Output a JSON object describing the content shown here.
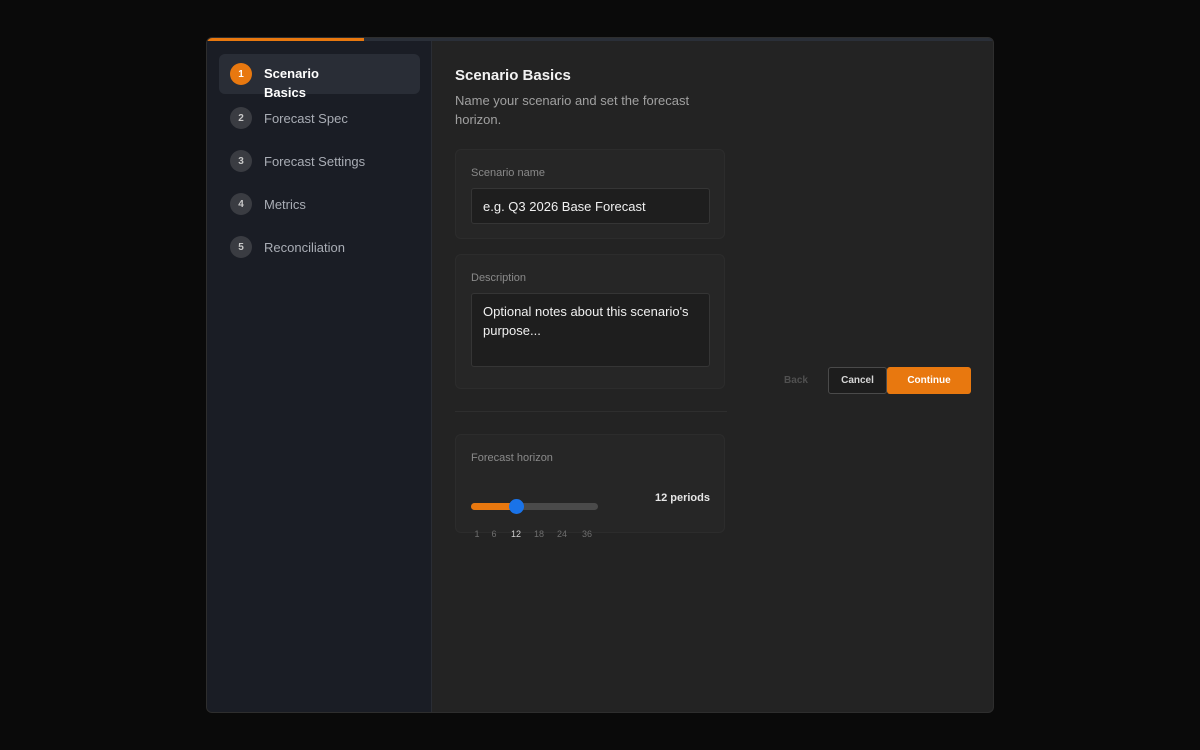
{
  "wizard": {
    "progress_fraction": 0.2,
    "steps": [
      {
        "number": "1",
        "label": "Scenario Basics",
        "active": true
      },
      {
        "number": "2",
        "label": "Forecast Spec",
        "active": false
      },
      {
        "number": "3",
        "label": "Forecast Settings",
        "active": false
      },
      {
        "number": "4",
        "label": "Metrics",
        "active": false
      },
      {
        "number": "5",
        "label": "Reconciliation",
        "active": false
      }
    ]
  },
  "main": {
    "title": "Scenario Basics",
    "subtitle": "Name your scenario and set the forecast horizon."
  },
  "scenario_name": {
    "label": "Scenario name",
    "placeholder": "e.g. Q3 2026 Base Forecast",
    "value": ""
  },
  "description": {
    "label": "Description",
    "placeholder": "Optional notes about this scenario's purpose...",
    "value": ""
  },
  "horizon": {
    "label": "Forecast horizon",
    "value_text": "12 periods",
    "value": 12,
    "ticks": [
      "1",
      "6",
      "12",
      "18",
      "24",
      "36"
    ],
    "selected_tick": "12"
  },
  "actions": {
    "back_label": "Back",
    "cancel_label": "Cancel",
    "continue_label": "Continue"
  },
  "colors": {
    "accent": "#e8780f",
    "slider_thumb": "#1a73e8"
  }
}
